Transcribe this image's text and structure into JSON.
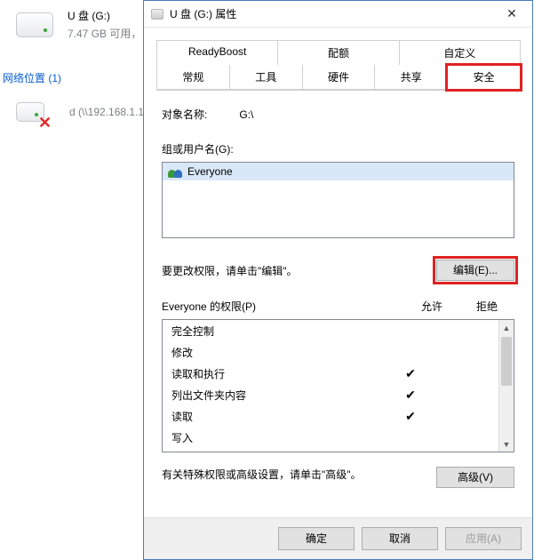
{
  "background": {
    "drive_label": "U 盘 (G:)",
    "drive_sub": "7.47 GB 可用，",
    "section_label": "网络位置 (1)",
    "net_drive_label": "d (\\\\192.168.1.1"
  },
  "dialog": {
    "title": "U 盘 (G:) 属性",
    "tabs_top": [
      "ReadyBoost",
      "配额",
      "自定义"
    ],
    "tabs_bottom": [
      "常规",
      "工具",
      "硬件",
      "共享",
      "安全"
    ],
    "active_tab": "安全",
    "object_name_label": "对象名称:",
    "object_name_value": "G:\\",
    "groups_label": "组或用户名(G):",
    "groups": [
      "Everyone"
    ],
    "edit_hint": "要更改权限，请单击\"编辑\"。",
    "edit_button": "编辑(E)...",
    "perm_label_prefix": "Everyone 的权限(P)",
    "col_allow": "允许",
    "col_deny": "拒绝",
    "permissions": [
      {
        "name": "完全控制",
        "allow": false,
        "deny": false
      },
      {
        "name": "修改",
        "allow": false,
        "deny": false
      },
      {
        "name": "读取和执行",
        "allow": true,
        "deny": false
      },
      {
        "name": "列出文件夹内容",
        "allow": true,
        "deny": false
      },
      {
        "name": "读取",
        "allow": true,
        "deny": false
      },
      {
        "name": "写入",
        "allow": false,
        "deny": false
      }
    ],
    "advanced_hint": "有关特殊权限或高级设置，请单击\"高级\"。",
    "advanced_button": "高级(V)",
    "footer": {
      "ok": "确定",
      "cancel": "取消",
      "apply": "应用(A)"
    }
  }
}
